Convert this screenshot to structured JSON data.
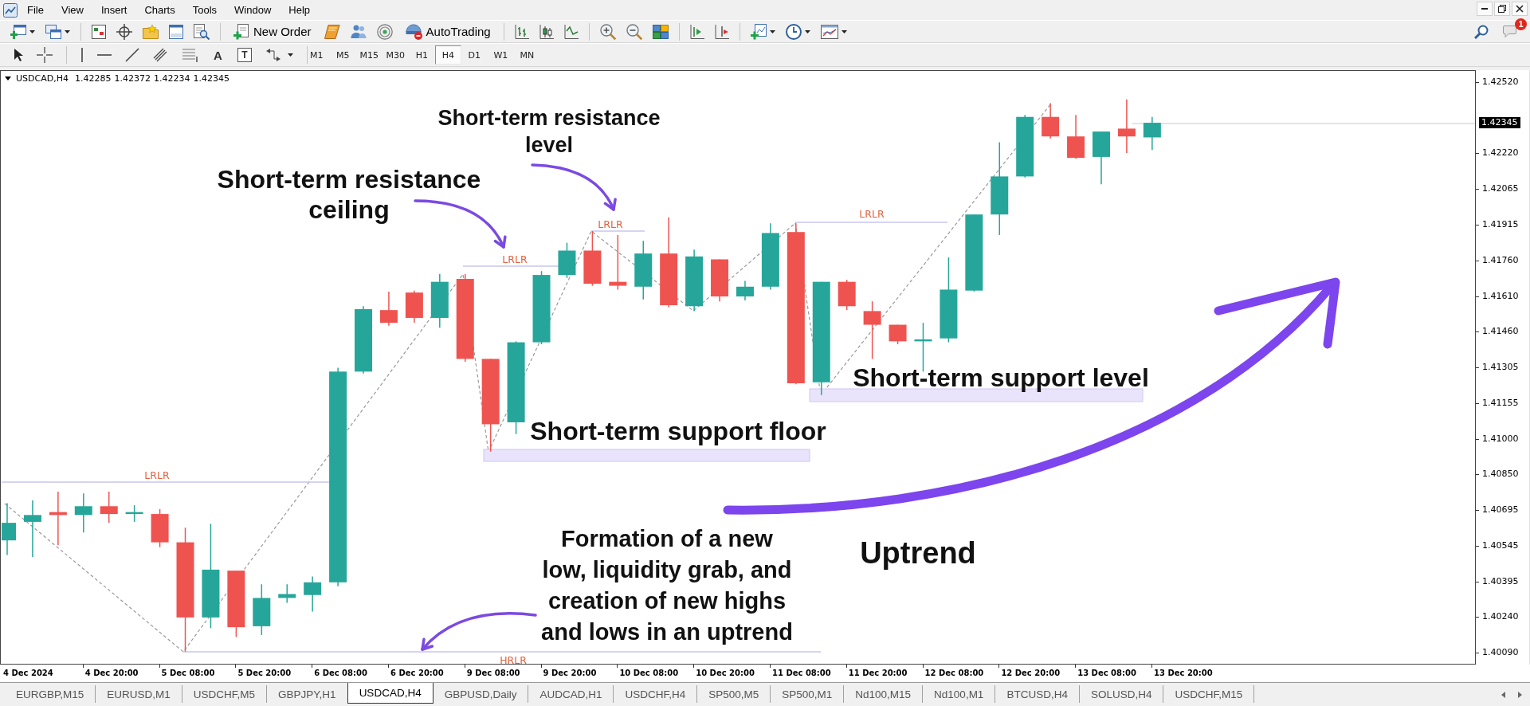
{
  "menu_bar": {
    "items": [
      "File",
      "View",
      "Insert",
      "Charts",
      "Tools",
      "Window",
      "Help"
    ]
  },
  "toolbar": {
    "buttons": [
      {
        "kind": "new_order",
        "label": "New Order"
      },
      {
        "kind": "autotrading",
        "label": "AutoTrading"
      }
    ],
    "notifications": "1"
  },
  "drawing_toolbar": {
    "text_tool": "A",
    "label_tool": "T"
  },
  "timeframes": [
    {
      "label": "M1",
      "selected": false
    },
    {
      "label": "M5",
      "selected": false
    },
    {
      "label": "M15",
      "selected": false
    },
    {
      "label": "M30",
      "selected": false
    },
    {
      "label": "H1",
      "selected": false
    },
    {
      "label": "H4",
      "selected": true
    },
    {
      "label": "D1",
      "selected": false
    },
    {
      "label": "W1",
      "selected": false
    },
    {
      "label": "MN",
      "selected": false
    }
  ],
  "chart": {
    "symbol": "USDCAD,H4",
    "quote": [
      "1.42285",
      "1.42372",
      "1.42234",
      "1.42345"
    ],
    "current_price": "1.42345",
    "price_axis": [
      "1.42520",
      "1.42220",
      "1.42065",
      "1.41915",
      "1.41760",
      "1.41610",
      "1.41460",
      "1.41305",
      "1.41155",
      "1.41000",
      "1.40850",
      "1.40695",
      "1.40545",
      "1.40395",
      "1.40240",
      "1.40090"
    ],
    "time_axis": [
      "4 Dec 2024",
      "4 Dec 20:00",
      "5 Dec 08:00",
      "5 Dec 20:00",
      "6 Dec 08:00",
      "6 Dec 20:00",
      "9 Dec 08:00",
      "9 Dec 20:00",
      "10 Dec 08:00",
      "10 Dec 20:00",
      "11 Dec 08:00",
      "11 Dec 20:00",
      "12 Dec 08:00",
      "12 Dec 20:00",
      "13 Dec 08:00",
      "13 Dec 20:00"
    ],
    "level_labels": [
      "LRLR",
      "LRLR",
      "LRLR",
      "LRLR",
      "HRLR"
    ],
    "annotations": [
      {
        "lines": [
          "Short-term resistance",
          "level"
        ]
      },
      {
        "lines": [
          "Short-term resistance",
          "ceiling"
        ]
      },
      {
        "lines": [
          "Short-term support level"
        ]
      },
      {
        "lines": [
          "Short-term support floor"
        ]
      },
      {
        "lines": [
          "Formation of a new",
          "low, liquidity grab, and",
          "creation of new highs",
          "and lows in an uptrend"
        ]
      },
      {
        "lines": [
          "Uptrend"
        ]
      }
    ]
  },
  "tabs": [
    {
      "label": "EURGBP,M15",
      "selected": false
    },
    {
      "label": "EURUSD,M1",
      "selected": false
    },
    {
      "label": "USDCHF,M5",
      "selected": false
    },
    {
      "label": "GBPJPY,H1",
      "selected": false
    },
    {
      "label": "USDCAD,H4",
      "selected": true
    },
    {
      "label": "GBPUSD,Daily",
      "selected": false
    },
    {
      "label": "AUDCAD,H1",
      "selected": false
    },
    {
      "label": "USDCHF,H4",
      "selected": false
    },
    {
      "label": "SP500,M5",
      "selected": false
    },
    {
      "label": "SP500,M1",
      "selected": false
    },
    {
      "label": "Nd100,M15",
      "selected": false
    },
    {
      "label": "Nd100,M1",
      "selected": false
    },
    {
      "label": "BTCUSD,H4",
      "selected": false
    },
    {
      "label": "SOLUSD,H4",
      "selected": false
    },
    {
      "label": "USDCHF,M15",
      "selected": false
    }
  ]
}
